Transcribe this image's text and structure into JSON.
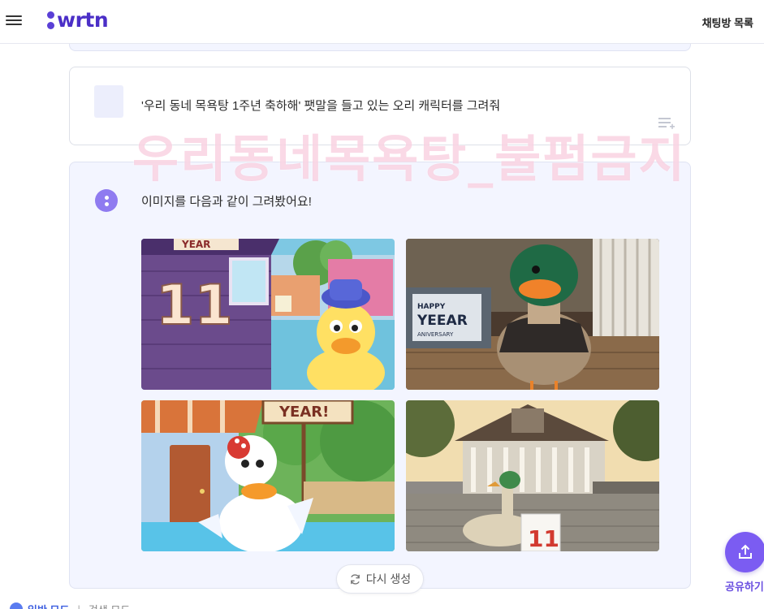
{
  "header": {
    "logo_text": "wrtn",
    "chat_list_label": "채팅방 목록"
  },
  "user_message": {
    "text": "'우리 동네 목욕탕 1주년 축하해' 팻말을 들고 있는 오리 캐릭터를 그려줘"
  },
  "watermark": {
    "text": "우리동네목욕탕_불펌금지"
  },
  "assistant_message": {
    "text": "이미지를 다음과 같이 그려봤어요!",
    "images": [
      {
        "icon": "cartoon-duck-blue-hat",
        "sign_text": "YEAR",
        "number_text": "11"
      },
      {
        "icon": "mallard-duck-sign",
        "sign_line1": "HAPPY",
        "sign_line2": "YEEAR",
        "sign_line3": "ANIVERSARY"
      },
      {
        "icon": "cartoon-white-duck",
        "sign_text": "YEAR!"
      },
      {
        "icon": "duck-bathhouse",
        "number_text": "11"
      }
    ]
  },
  "actions": {
    "regenerate_label": "다시 생성",
    "share_label": "공유하기"
  },
  "mode_bar": {
    "general_label": "일반 모드",
    "search_label": "검색 모드"
  },
  "colors": {
    "brand": "#5a3fd6",
    "share": "#7b5cf2",
    "card_bg": "#f3f5ff"
  }
}
